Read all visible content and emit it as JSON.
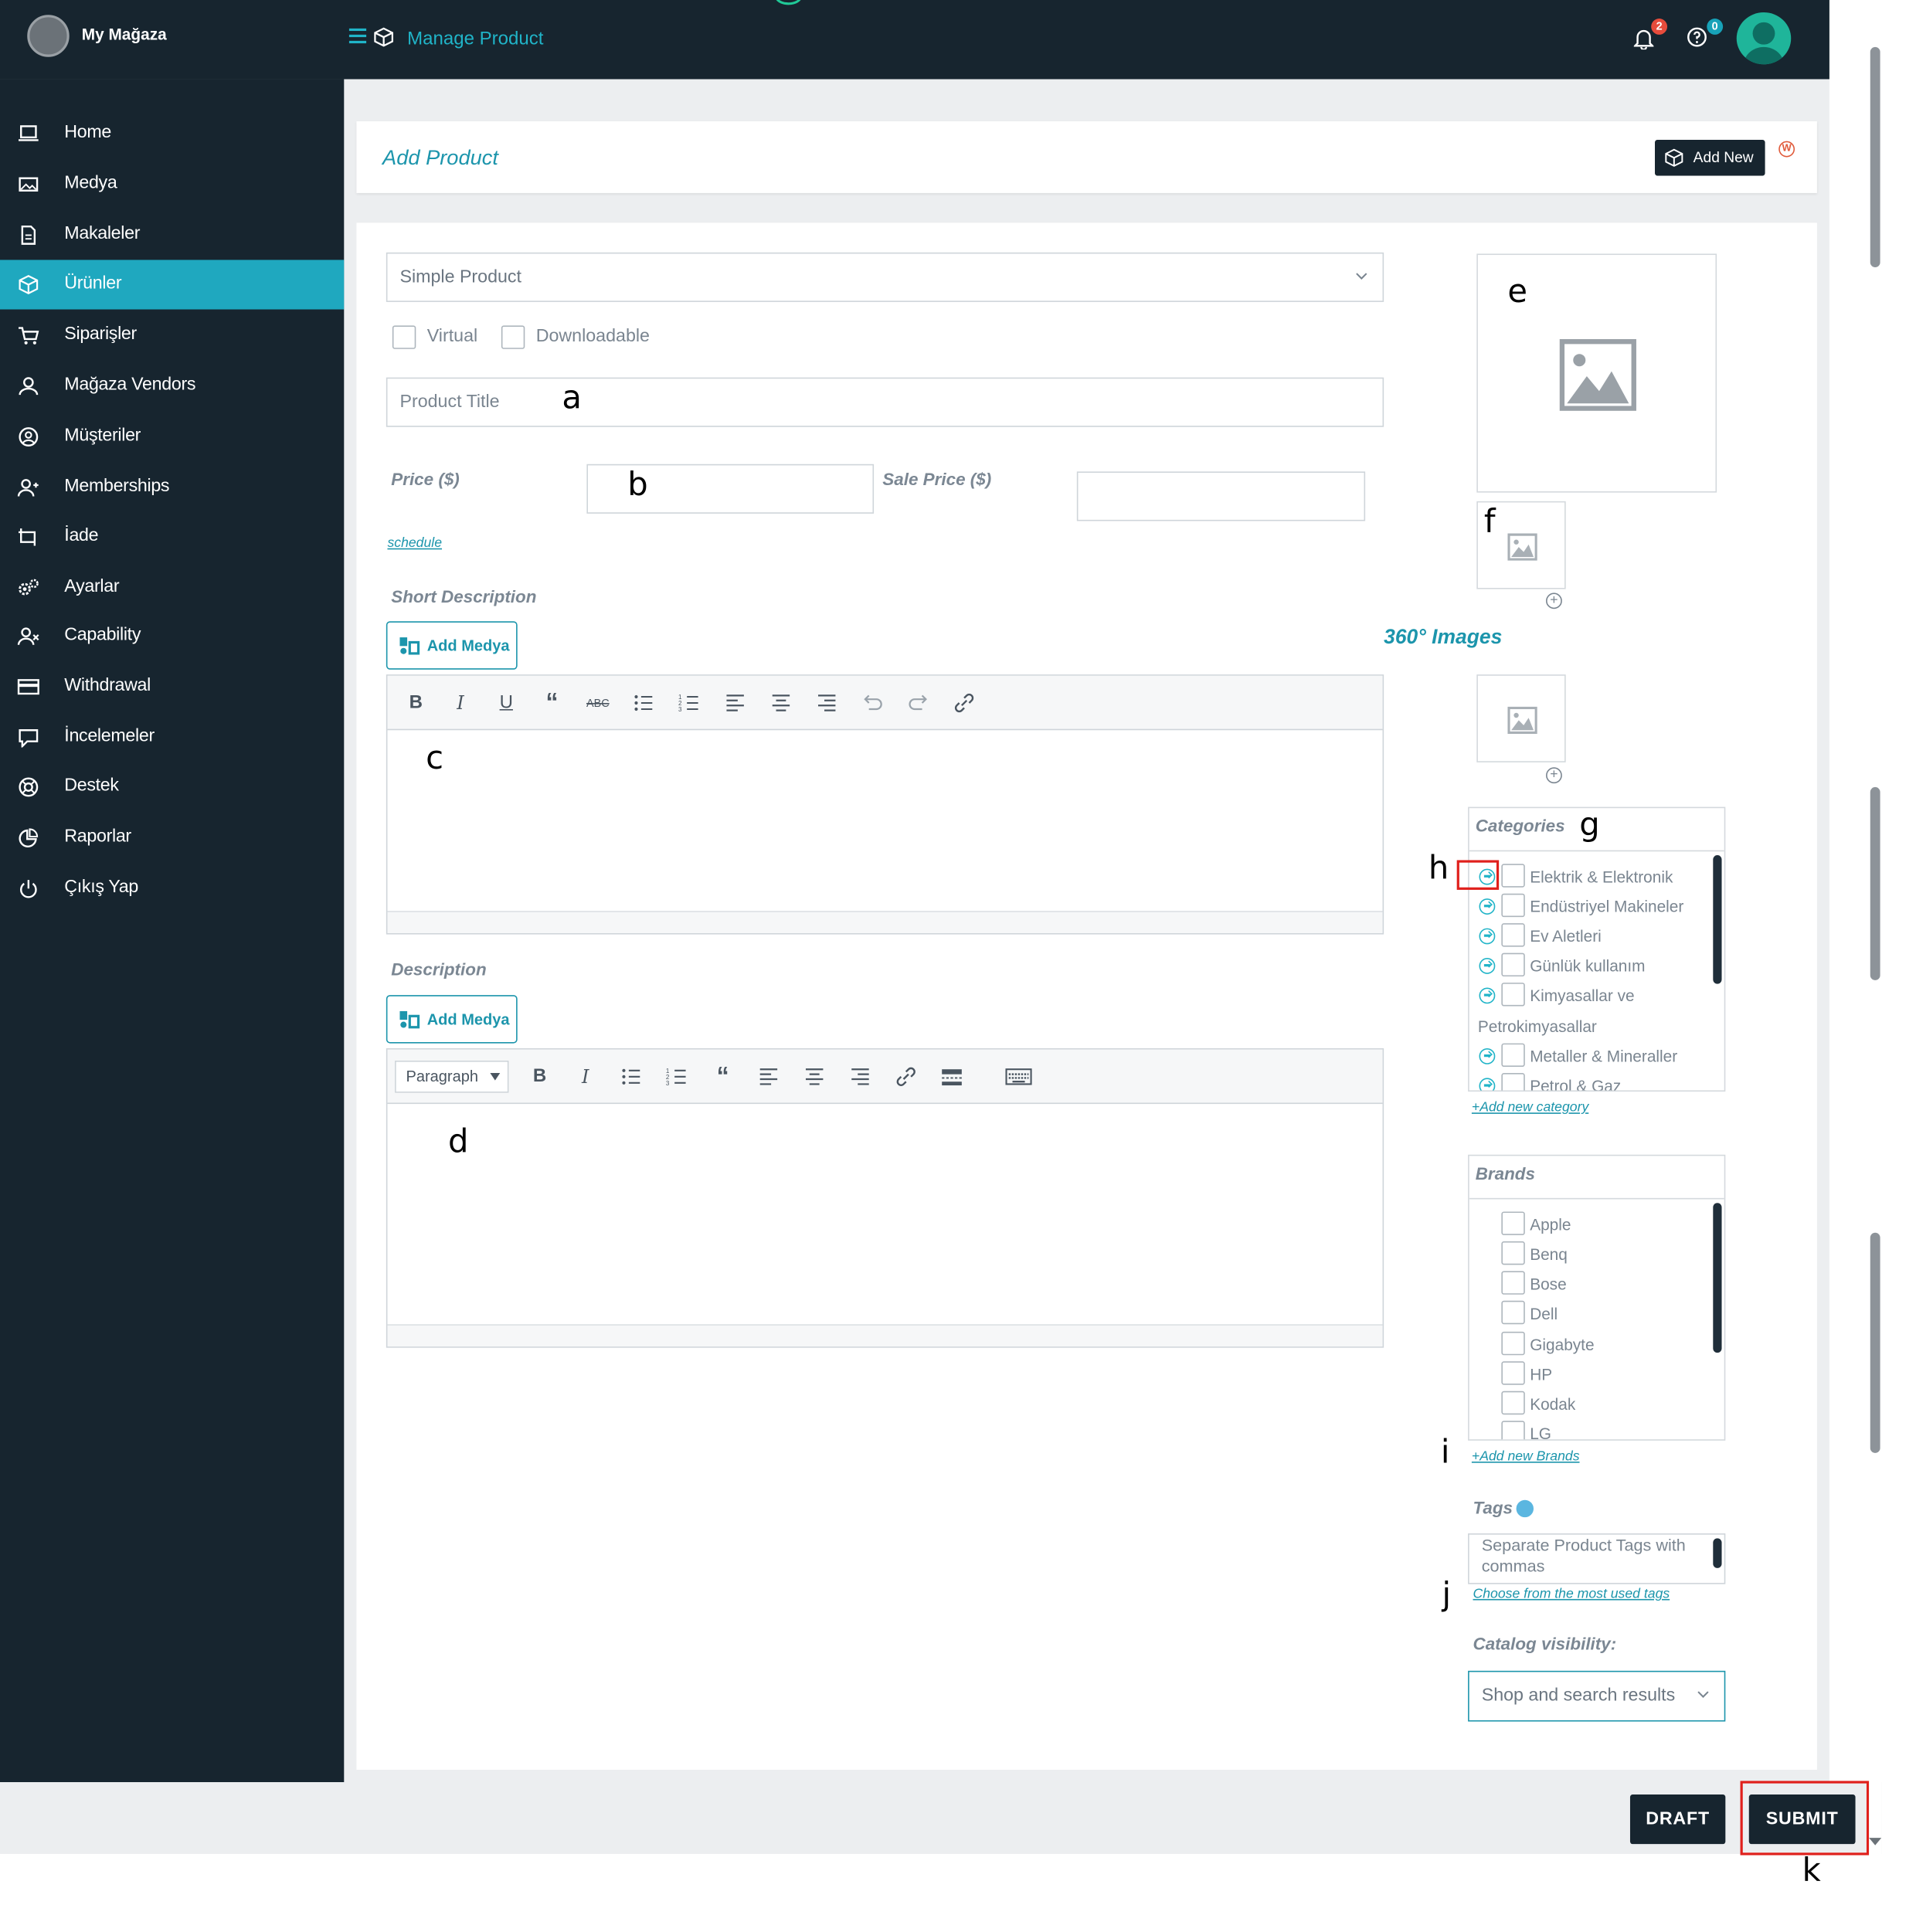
{
  "app": {
    "store_name": "My Mağaza",
    "page_link": "Manage Product",
    "notifications_count": "2",
    "help_count": "0"
  },
  "sidebar": {
    "items": [
      {
        "label": "Home",
        "icon": "laptop-icon"
      },
      {
        "label": "Medya",
        "icon": "image-icon"
      },
      {
        "label": "Makaleler",
        "icon": "document-icon"
      },
      {
        "label": "Ürünler",
        "icon": "box-icon",
        "active": true
      },
      {
        "label": "Siparişler",
        "icon": "cart-icon"
      },
      {
        "label": "Mağaza Vendors",
        "icon": "user-icon"
      },
      {
        "label": "Müşteriler",
        "icon": "user-circle-icon"
      },
      {
        "label": "Memberships",
        "icon": "user-plus-icon"
      },
      {
        "label": "İade",
        "icon": "refund-icon"
      },
      {
        "label": "Ayarlar",
        "icon": "gears-icon"
      },
      {
        "label": "Capability",
        "icon": "user-x-icon"
      },
      {
        "label": "Withdrawal",
        "icon": "credit-card-icon"
      },
      {
        "label": "İncelemeler",
        "icon": "comment-icon"
      },
      {
        "label": "Destek",
        "icon": "life-ring-icon"
      },
      {
        "label": "Raporlar",
        "icon": "pie-chart-icon"
      },
      {
        "label": "Çıkış Yap",
        "icon": "power-icon"
      }
    ]
  },
  "header": {
    "title": "Add Product",
    "add_new_label": "Add New"
  },
  "form": {
    "product_type": "Simple Product",
    "virtual_label": "Virtual",
    "downloadable_label": "Downloadable",
    "title_placeholder": "Product Title",
    "price_label": "Price ($)",
    "sale_price_label": "Sale Price ($)",
    "schedule_link": "schedule",
    "short_description_label": "Short Description",
    "description_label": "Description",
    "add_media_label": "Add Medya",
    "paragraph_label": "Paragraph"
  },
  "side": {
    "images_360_label": "360° Images",
    "categories_title": "Categories",
    "categories": [
      "Elektrik & Elektronik",
      "Endüstriyel Makineler",
      "Ev Aletleri",
      "Günlük kullanım",
      "Kimyasallar ve",
      "Metaller & Mineraller",
      "Petrol & Gaz"
    ],
    "categories_wrap": "Petrokimyasallar",
    "add_category_link": "+Add new category",
    "brands_title": "Brands",
    "brands": [
      "Apple",
      "Benq",
      "Bose",
      "Dell",
      "Gigabyte",
      "HP",
      "Kodak",
      "LG"
    ],
    "add_brands_link": "+Add new Brands",
    "tags_label": "Tags",
    "tags_placeholder": "Separate Product Tags with commas",
    "tags_link": "Choose from the most used tags",
    "catalog_visibility_label": "Catalog visibility:",
    "catalog_visibility_value": "Shop and search results"
  },
  "footer": {
    "draft_label": "DRAFT",
    "submit_label": "SUBMIT"
  },
  "annotations": {
    "a": "a",
    "b": "b",
    "c": "c",
    "d": "d",
    "e": "e",
    "f": "f",
    "g": "g",
    "h": "h",
    "i": "i",
    "j": "j",
    "k": "k"
  },
  "colors": {
    "sidebar_bg": "#17252f",
    "accent": "#1fa8bf",
    "annotation_box": "#e0201c"
  }
}
